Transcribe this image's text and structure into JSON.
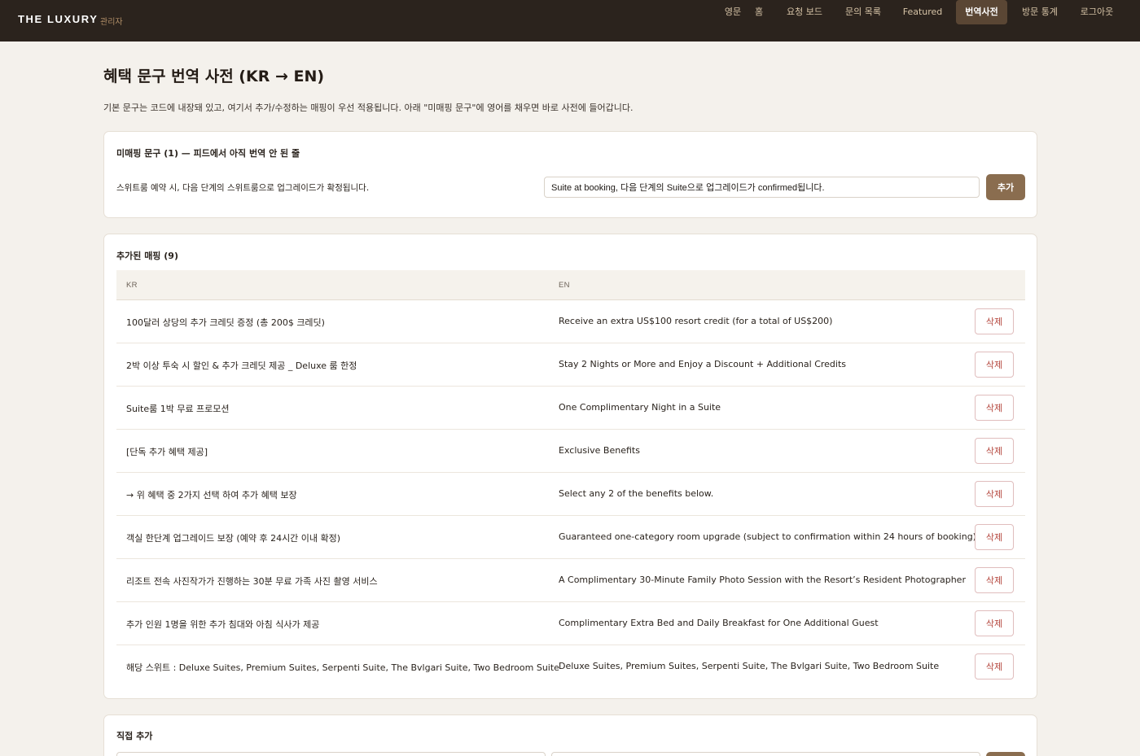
{
  "header": {
    "brand": "THE LUXURY",
    "brand_sub": "관리자",
    "nav": [
      {
        "label": "영문",
        "active": false
      },
      {
        "label": "홈",
        "active": false
      },
      {
        "label": "요청 보드",
        "active": false
      },
      {
        "label": "문의 목록",
        "active": false
      },
      {
        "label": "Featured",
        "active": false
      },
      {
        "label": "번역사전",
        "active": true
      },
      {
        "label": "방문 통계",
        "active": false
      },
      {
        "label": "로그아웃",
        "active": false
      }
    ]
  },
  "page": {
    "title": "혜택 문구 번역 사전 (KR → EN)",
    "description": "기본 문구는 코드에 내장돼 있고, 여기서 추가/수정하는 매핑이 우선 적용됩니다. 아래 \"미매핑 문구\"에 영어를 채우면 바로 사전에 들어갑니다."
  },
  "unmapped": {
    "title": "미매핑 문구 (1) — 피드에서 아직 번역 안 된 줄",
    "items": [
      {
        "kr": "스위트룸 예약 시, 다음 단계의 스위트룸으로 업그레이드가 확정됩니다.",
        "en_value": "Suite at booking, 다음 단계의 Suite으로 업그레이드가 confirmed됩니다.",
        "add_label": "추가"
      }
    ]
  },
  "mappings": {
    "title": "추가된 매핑 (9)",
    "columns": {
      "kr": "KR",
      "en": "EN"
    },
    "delete_label": "삭제",
    "rows": [
      {
        "kr": "100달러 상당의 추가 크레딧 증정 (총 200$ 크레딧)",
        "en": "Receive an extra US$100 resort credit (for a total of US$200)"
      },
      {
        "kr": "2박 이상 투숙 시 할인 & 추가 크레딧 제공 _ Deluxe 룸 한정",
        "en": "Stay 2 Nights or More and Enjoy a Discount + Additional Credits"
      },
      {
        "kr": "Suite룸 1박 무료 프로모션",
        "en": "One Complimentary Night in a Suite"
      },
      {
        "kr": "[단독 추가 혜택 제공]",
        "en": "Exclusive Benefits"
      },
      {
        "kr": "→ 위 혜택 중 2가지 선택 하여 추가 혜택 보장",
        "en": "Select any 2 of the benefits below."
      },
      {
        "kr": "객실 한단계 업그레이드 보장 (예약 후 24시간 이내 확정)",
        "en": "Guaranteed one-category room upgrade (subject to confirmation within 24 hours of booking)"
      },
      {
        "kr": "리조트 전속 사진작가가 진행하는 30분 무료 가족 사진 촬영 서비스",
        "en": "A Complimentary 30-Minute Family Photo Session with the Resort’s Resident Photographer"
      },
      {
        "kr": "추가 인원 1명을 위한 추가 침대와 아침 식사가 제공",
        "en": "Complimentary Extra Bed and Daily Breakfast for One Additional Guest"
      },
      {
        "kr": "해당 스위트 : Deluxe Suites, Premium Suites, Serpenti Suite, The Bvlgari Suite, Two Bedroom Suite",
        "en": "Deluxe Suites, Premium Suites, Serpenti Suite, The Bvlgari Suite, Two Bedroom Suite"
      }
    ]
  },
  "direct_add": {
    "title": "직접 추가"
  }
}
